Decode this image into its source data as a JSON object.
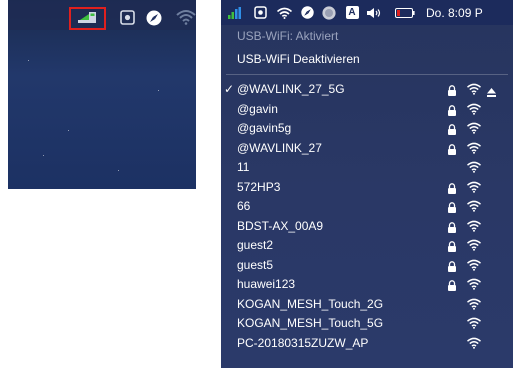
{
  "menubar": {
    "clock": "Do. 8:09 P",
    "input_source": "A"
  },
  "usb_wifi": {
    "status": "USB-WiFi: Aktiviert",
    "toggle": "USB-WiFi Deaktivieren"
  },
  "networks": [
    {
      "name": "@WAVLINK_27_5G",
      "selected": true,
      "locked": true
    },
    {
      "name": "@gavin",
      "selected": false,
      "locked": true
    },
    {
      "name": "@gavin5g",
      "selected": false,
      "locked": true
    },
    {
      "name": "@WAVLINK_27",
      "selected": false,
      "locked": true
    },
    {
      "name": "11",
      "selected": false,
      "locked": false
    },
    {
      "name": "572HP3",
      "selected": false,
      "locked": true
    },
    {
      "name": "66",
      "selected": false,
      "locked": true
    },
    {
      "name": "BDST-AX_00A9",
      "selected": false,
      "locked": true
    },
    {
      "name": "guest2",
      "selected": false,
      "locked": true
    },
    {
      "name": "guest5",
      "selected": false,
      "locked": true
    },
    {
      "name": "huawei123",
      "selected": false,
      "locked": true
    },
    {
      "name": "KOGAN_MESH_Touch_2G",
      "selected": false,
      "locked": false
    },
    {
      "name": "KOGAN_MESH_Touch_5G",
      "selected": false,
      "locked": false
    },
    {
      "name": "PC-20180315ZUZW_AP",
      "selected": false,
      "locked": false
    }
  ],
  "icons": {
    "left_bar": [
      "network-status-icon",
      "screen-capture-icon",
      "compass-icon",
      "wifi-icon"
    ],
    "menubar": [
      "signal-bars-icon",
      "screen-capture-icon",
      "wifi-icon",
      "compass-icon",
      "siri-icon",
      "input-source-icon",
      "volume-icon",
      "battery-icon"
    ],
    "row": [
      "checkmark-icon",
      "lock-icon",
      "wifi-icon",
      "eject-icon"
    ]
  },
  "colors": {
    "menu_bg": "#2a3866",
    "highlight_box": "#e0201e",
    "signal_green": "#3fbf3f",
    "signal_blue": "#2f8fe8",
    "battery_red": "#e0201e"
  }
}
